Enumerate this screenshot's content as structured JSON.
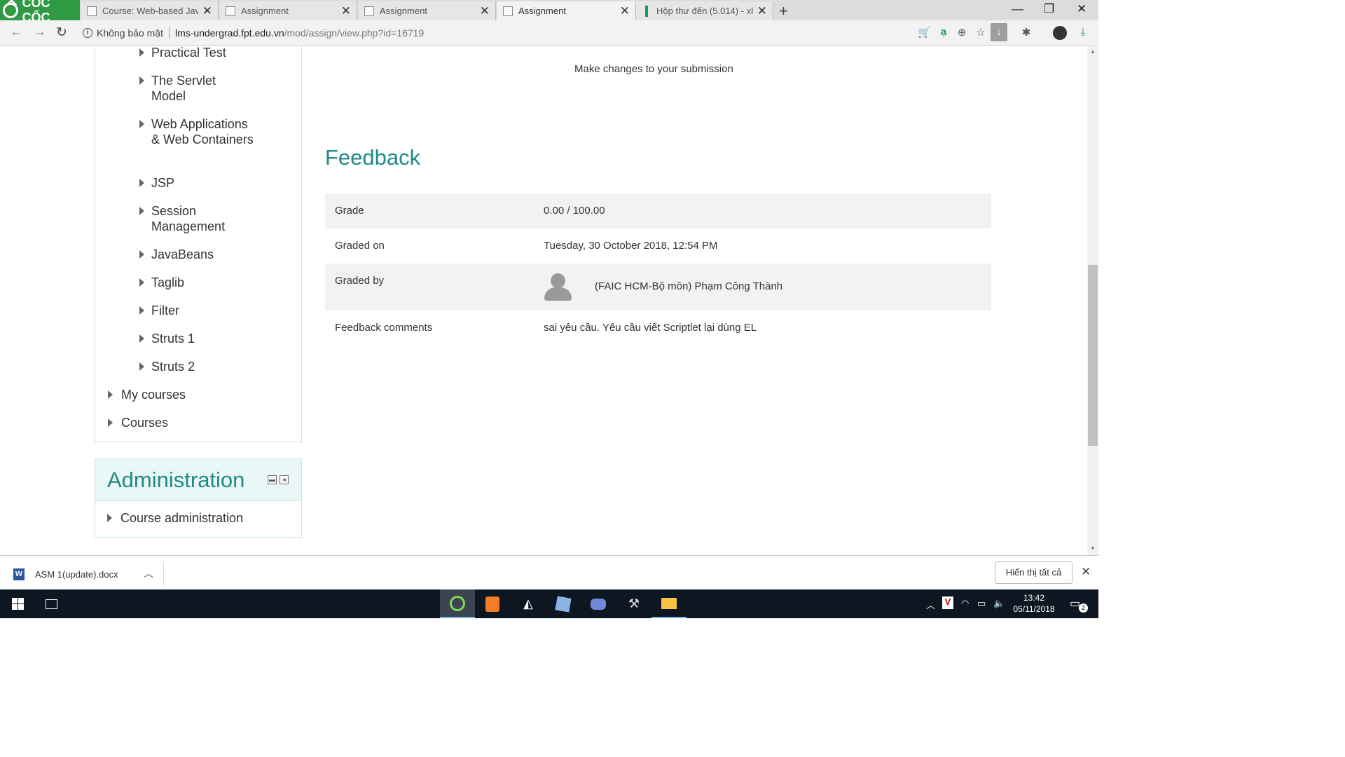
{
  "browser": {
    "brand": "CỐC CỐC",
    "tabs": [
      {
        "label": "Course: Web-based Java",
        "active": false
      },
      {
        "label": "Assignment",
        "active": false
      },
      {
        "label": "Assignment",
        "active": false
      },
      {
        "label": "Assignment",
        "active": true
      },
      {
        "label": "Hộp thư đến (5.014) - xh",
        "active": false
      }
    ],
    "security_text": "Không bảo mật",
    "url_host": "lms-undergrad.fpt.edu.vn",
    "url_path": "/mod/assign/view.php?id=16719",
    "accent_color": "#2f9a43"
  },
  "sidebar": {
    "course_items": [
      {
        "label": "Practical Test"
      },
      {
        "label": "The Servlet Model"
      },
      {
        "label": "Web Applications & Web Containers"
      },
      {
        "label": "JSP"
      },
      {
        "label": "Session Management"
      },
      {
        "label": "JavaBeans"
      },
      {
        "label": "Taglib"
      },
      {
        "label": "Filter"
      },
      {
        "label": "Struts 1"
      },
      {
        "label": "Struts 2"
      }
    ],
    "top_items": [
      {
        "label": "My courses"
      },
      {
        "label": "Courses"
      }
    ],
    "admin": {
      "title": "Administration",
      "items": [
        {
          "label": "Course administration"
        }
      ]
    }
  },
  "main": {
    "submission_link": "Make changes to your submission",
    "feedback_title": "Feedback",
    "feedback": {
      "grade_label": "Grade",
      "grade_value": "0.00 / 100.00",
      "graded_on_label": "Graded on",
      "graded_on_value": "Tuesday, 30 October 2018, 12:54 PM",
      "graded_by_label": "Graded by",
      "graded_by_value": "(FAIC HCM-Bộ môn) Phạm Công Thành",
      "comments_label": "Feedback comments",
      "comments_value": "sai yêu cầu. Yêu cầu viết Scriptlet lại dùng EL"
    },
    "heading_color": "#1f8a86"
  },
  "downloads": {
    "file_name": "ASM 1(update).docx",
    "show_all": "Hiển thị tất cả"
  },
  "taskbar": {
    "time": "13:42",
    "date": "05/11/2018",
    "notification_count": "2"
  }
}
